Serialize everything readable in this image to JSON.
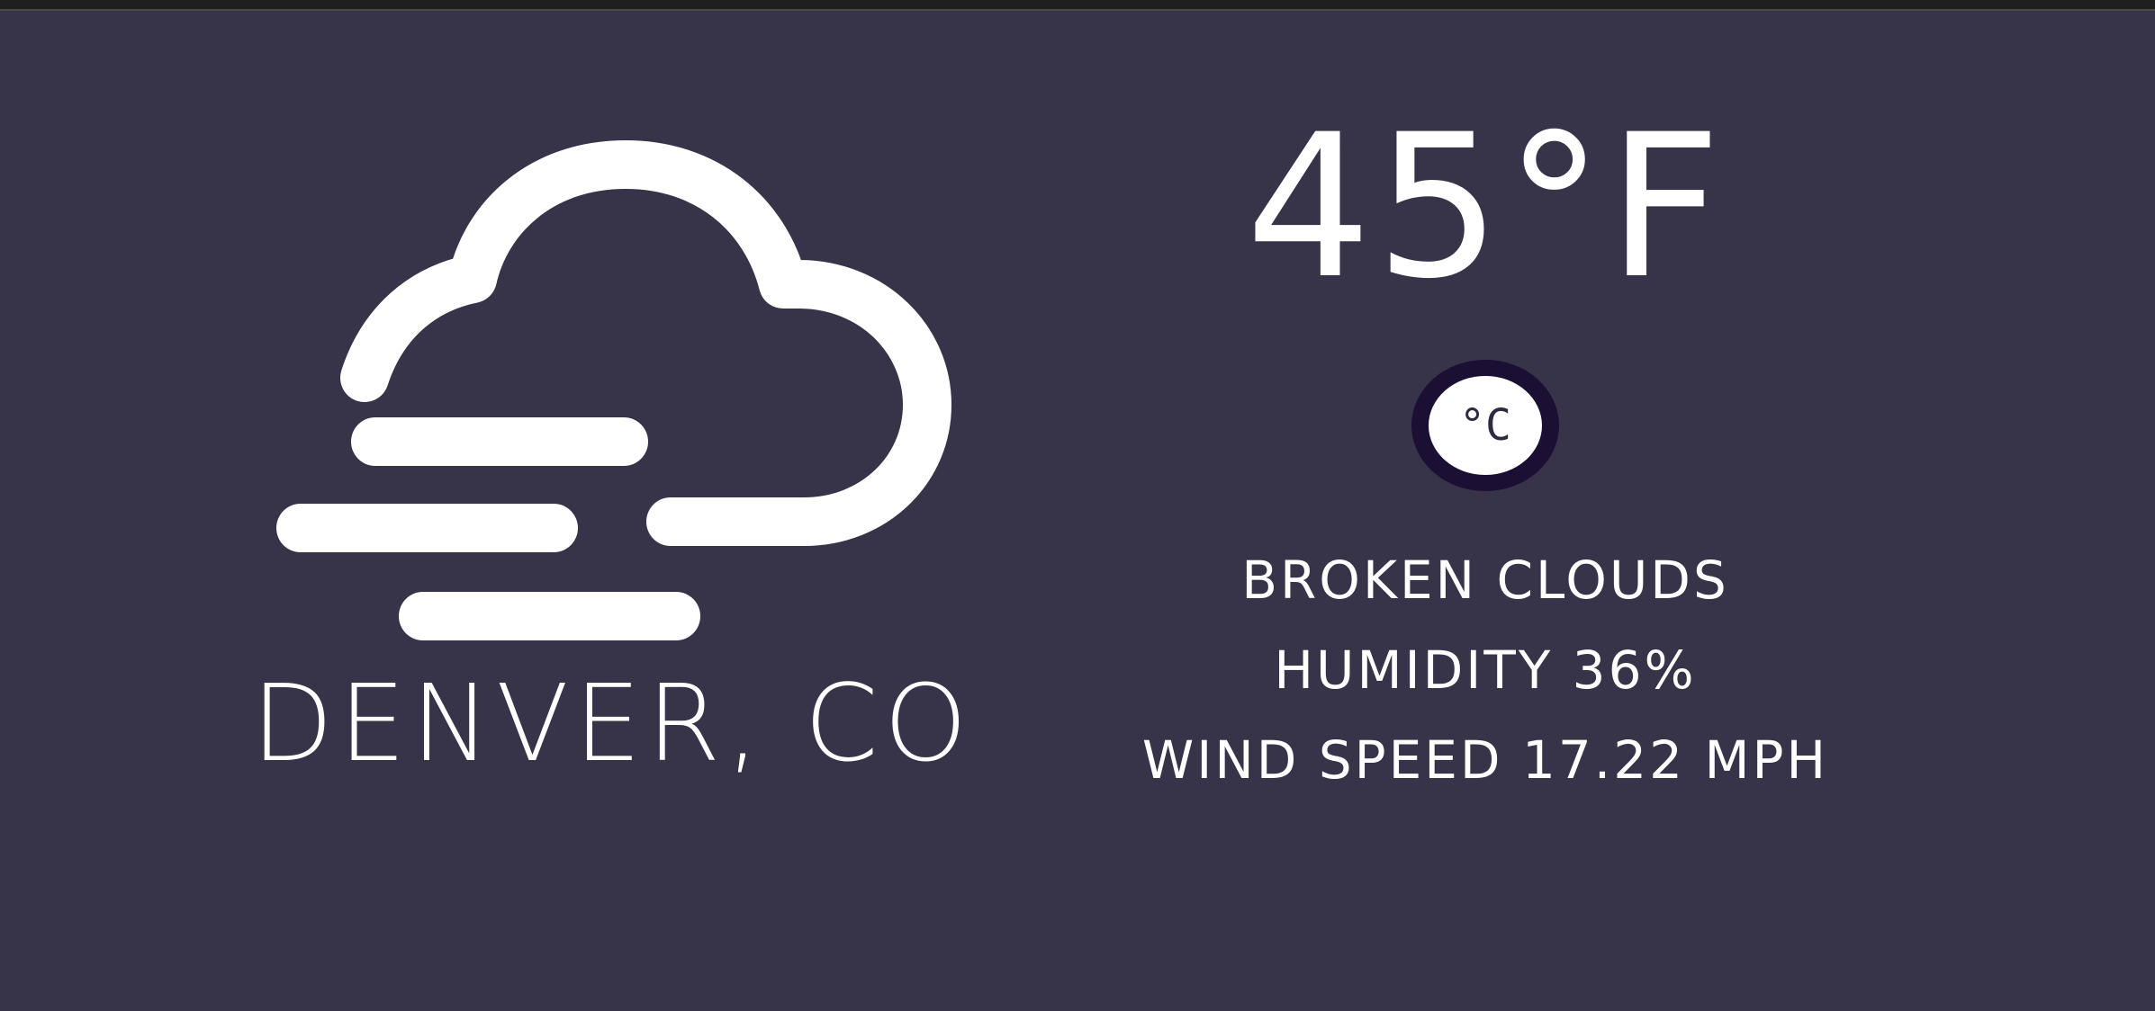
{
  "location": {
    "city": "DENVER, CO"
  },
  "weather": {
    "icon": "broken-clouds-wind-icon",
    "temperature": "45°F",
    "unit_toggle_label": "°C",
    "description": "BROKEN CLOUDS",
    "humidity": "HUMIDITY 36%",
    "wind_speed": "WIND SPEED 17.22 MPH"
  },
  "colors": {
    "background": "#373349",
    "foreground": "#ffffff",
    "toggle_ring": "#1b0f33",
    "toggle_text": "#2e2a3f"
  }
}
